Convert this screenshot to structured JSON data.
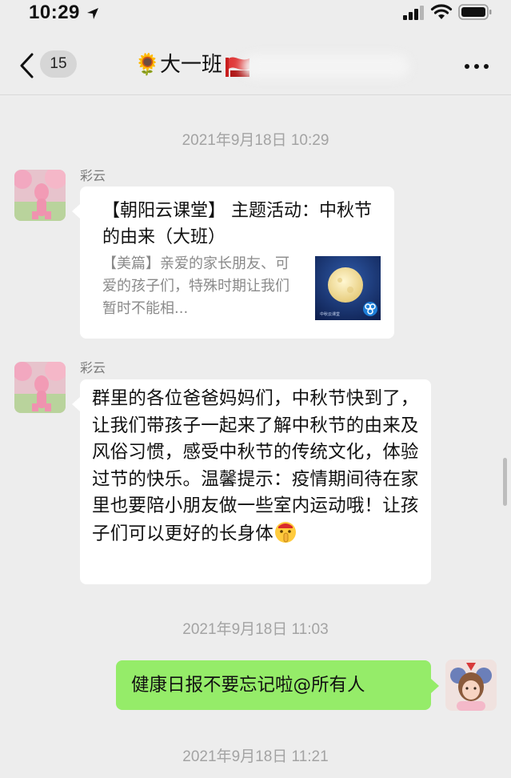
{
  "status_bar": {
    "time": "10:29"
  },
  "nav": {
    "unread_count": "15",
    "title_emoji": "🌻",
    "title": "大一班"
  },
  "messages": [
    {
      "type": "timestamp",
      "text": "2021年9月18日 10:29"
    },
    {
      "type": "link_card",
      "sender": "彩云",
      "title": "【朝阳云课堂】 主题活动：中秋节的由来（大班）",
      "description": "【美篇】亲爱的家长朋友、可爱的孩子们，特殊时期让我们暂时不能相...",
      "thumbnail_caption": "中秋云课堂"
    },
    {
      "type": "text",
      "sender": "彩云",
      "text": "群里的各位爸爸妈妈们，中秋节快到了，让我们带孩子一起来了解中秋节的由来及风俗习惯，感受中秋节的传统文化，体验过节的快乐。温馨提示：疫情期间待在家里也要陪小朋友做一些室内运动哦！让孩子们可以更好的长身体",
      "emoji": "shushing-face-emoji"
    },
    {
      "type": "timestamp",
      "text": "2021年9月18日 11:03"
    },
    {
      "type": "text_self",
      "text": "健康日报不要忘记啦@所有人"
    },
    {
      "type": "timestamp",
      "text": "2021年9月18日 11:21"
    }
  ],
  "colors": {
    "background": "#ededed",
    "self_bubble": "#95ec69",
    "other_bubble": "#ffffff",
    "timestamp_text": "#a3a3a3"
  }
}
